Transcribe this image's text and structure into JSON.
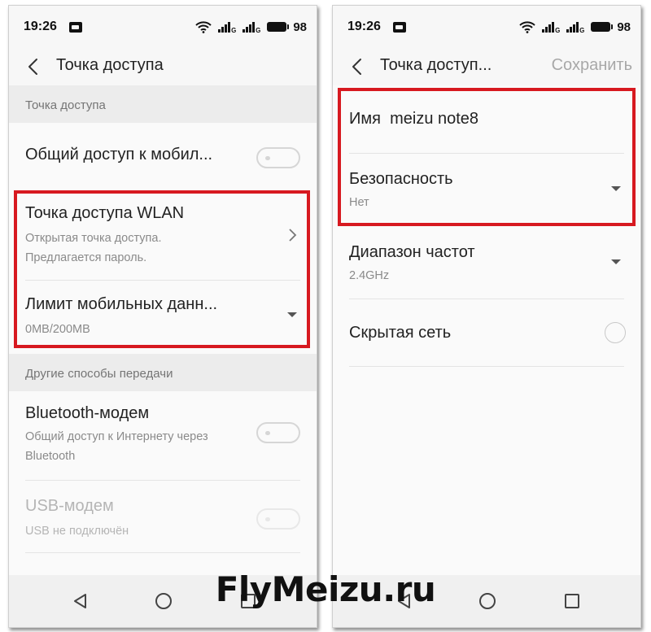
{
  "left_screen": {
    "status": {
      "time": "19:26",
      "battery": "98",
      "signal_label": "G"
    },
    "header": {
      "title": "Точка доступа"
    },
    "section1": {
      "title": "Точка доступа"
    },
    "mobile_sharing": {
      "label": "Общий доступ к мобил..."
    },
    "wlan": {
      "title": "Точка доступа WLAN",
      "sub1": "Открытая точка доступа.",
      "sub2": "Предлагается пароль."
    },
    "data_limit": {
      "title": "Лимит мобильных данн...",
      "value": "0MB/200MB"
    },
    "section2": {
      "title": "Другие способы передачи"
    },
    "bluetooth": {
      "title": "Bluetooth-модем",
      "sub1": "Общий доступ к Интернету через",
      "sub2": "Bluetooth"
    },
    "usb": {
      "title": "USB-модем",
      "sub": "USB не подключён"
    }
  },
  "right_screen": {
    "status": {
      "time": "19:26",
      "battery": "98",
      "signal_label": "G"
    },
    "header": {
      "title": "Точка доступ...",
      "save": "Сохранить"
    },
    "name": {
      "label": "Имя",
      "value": "meizu note8"
    },
    "security": {
      "title": "Безопасность",
      "value": "Нет"
    },
    "band": {
      "title": "Диапазон частот",
      "value": "2.4GHz"
    },
    "hidden": {
      "title": "Скрытая сеть"
    }
  },
  "watermark": {
    "text": "FlyMeizu.ru"
  },
  "colors": {
    "highlight": "#d71920",
    "background": "#fafafa",
    "section_bg": "#ececec"
  }
}
